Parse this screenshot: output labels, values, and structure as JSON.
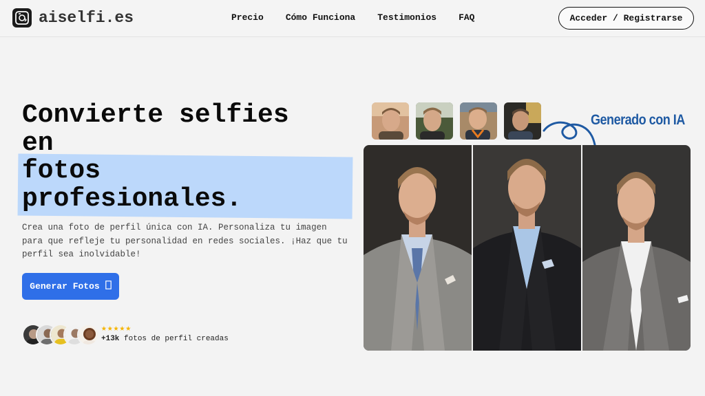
{
  "header": {
    "logo_text": "aiselfi.es",
    "nav": [
      "Precio",
      "Cómo Funciona",
      "Testimonios",
      "FAQ"
    ],
    "login_label": "Acceder / Registrarse"
  },
  "hero": {
    "title_lines": [
      "Convierte selfies",
      "en",
      "fotos",
      "profesionales."
    ],
    "description": "Crea una foto de perfil única con IA. Personaliza tu imagen para que refleje tu personalidad en redes sociales. ¡Haz que tu perfil sea inolvidable!",
    "cta_label": "Generar Fotos",
    "cta_icon": "camera-icon",
    "rating_stars": 5,
    "count_bold": "+13k",
    "count_rest": "fotos de perfil creadas"
  },
  "showcase": {
    "ai_label": "Generado con IA",
    "selfie_thumbnails": 4,
    "generated_photos": 3
  },
  "colors": {
    "accent_blue": "#2f6fe8",
    "highlight": "#bcd8fb",
    "ia_label": "#1f5aa3",
    "star": "#f5b400"
  }
}
